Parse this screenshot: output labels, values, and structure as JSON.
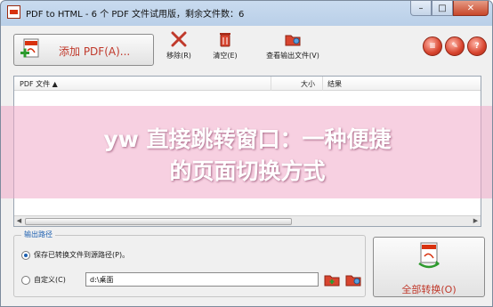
{
  "window": {
    "title": "PDF to HTML - 6 个 PDF 文件试用版，剩余文件数：6",
    "minimize": "–",
    "maximize": "□",
    "close": "✕"
  },
  "toolbar": {
    "add_pdf_label": "添加 PDF(A)...",
    "remove_label": "移除(R)",
    "clear_label": "清空(E)",
    "view_output_label": "查看输出文件(V)"
  },
  "file_list": {
    "columns": {
      "name": "PDF 文件 ▲",
      "size": "大小",
      "result": "结果"
    }
  },
  "output_path": {
    "group_title": "输出路径",
    "option_source": "保存已转换文件到源路径(P)。",
    "option_custom": "自定义(C)",
    "custom_path_value": "d:\\桌面"
  },
  "convert_all_label": "全部转换(O)",
  "overlay": {
    "line1": "yw 直接跳转窗口：一种便捷",
    "line2": "的页面切换方式"
  },
  "colors": {
    "accent_red": "#c0392b",
    "group_title_blue": "#1c5fb0",
    "overlay_pink": "#f0aac8"
  }
}
